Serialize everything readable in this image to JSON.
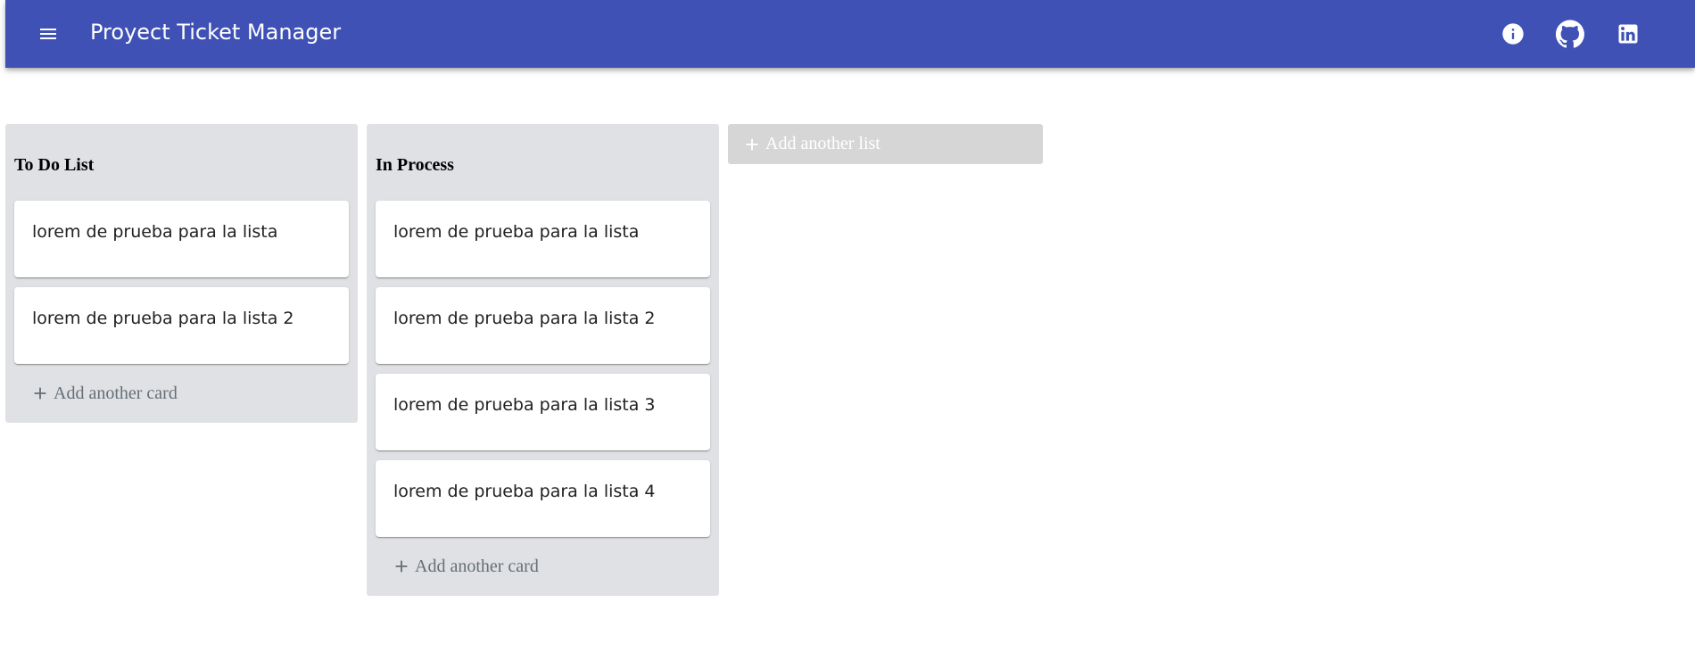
{
  "header": {
    "title": "Proyect Ticket Manager",
    "color": "#3f51b5",
    "menu_icon": "menu-icon",
    "actions": [
      {
        "icon": "info-icon"
      },
      {
        "icon": "github-icon"
      },
      {
        "icon": "linkedin-icon"
      }
    ]
  },
  "board": {
    "lists": [
      {
        "title": "To Do List",
        "cards": [
          {
            "text": "lorem de prueba para la lista"
          },
          {
            "text": "lorem de prueba para la lista 2"
          }
        ],
        "add_card_label": "Add another card"
      },
      {
        "title": "In Process",
        "cards": [
          {
            "text": "lorem de prueba para la lista"
          },
          {
            "text": "lorem de prueba para la lista 2"
          },
          {
            "text": "lorem de prueba para la lista 3"
          },
          {
            "text": "lorem de prueba para la lista 4"
          }
        ],
        "add_card_label": "Add another card"
      }
    ],
    "add_list_label": "Add another list",
    "list_color": "#dfe1e4",
    "add_list_color": "#d6d6d6"
  }
}
